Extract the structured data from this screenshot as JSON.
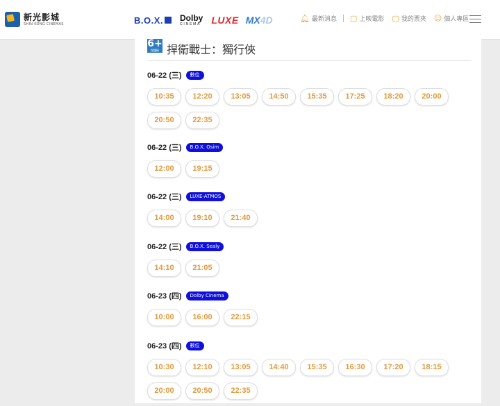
{
  "header": {
    "logo_zh": "新光影城",
    "logo_en": "SHIN KONG CINEMAS",
    "brands": {
      "box": "B.O.X.",
      "dolby_top": "Dolby",
      "dolby_bottom": "CINEMA",
      "luxe": "LUXE",
      "mx": "MX",
      "mx4d": "4D"
    },
    "nav": [
      "最新消息",
      "上映電影",
      "我的票夾",
      "個人專區"
    ],
    "icons": [
      "bell-icon",
      "ticket-icon",
      "ticket-icon",
      "user-icon"
    ],
    "accent": "#f2a33a"
  },
  "movie": {
    "rating": "6+",
    "rating_label": "保護級",
    "title": "捍衛戰士：獨行俠",
    "rating_color": "#2f7cc1"
  },
  "showtimes": [
    {
      "date": "06-22 (三)",
      "format": "數位",
      "times": [
        "10:35",
        "12:20",
        "13:05",
        "14:50",
        "15:35",
        "17:25",
        "18:20",
        "20:00",
        "20:50",
        "22:35"
      ]
    },
    {
      "date": "06-22 (三)",
      "format": "B.O.X. Osim",
      "times": [
        "12:00",
        "19:15"
      ]
    },
    {
      "date": "06-22 (三)",
      "format": "LUXE-ATMOS",
      "times": [
        "14:00",
        "19:10",
        "21:40"
      ]
    },
    {
      "date": "06-22 (三)",
      "format": "B.O.X. Sealy",
      "times": [
        "14:10",
        "21:05"
      ]
    },
    {
      "date": "06-23 (四)",
      "format": "Dolby Cinema",
      "times": [
        "10:00",
        "16:00",
        "22:15"
      ]
    },
    {
      "date": "06-23 (四)",
      "format": "數位",
      "times": [
        "10:30",
        "12:10",
        "13:05",
        "14:40",
        "15:35",
        "16:30",
        "17:20",
        "18:15",
        "20:00",
        "20:50",
        "22:35"
      ]
    }
  ],
  "colors": {
    "badge": "#1010dd",
    "time_text": "#e09a3c"
  }
}
